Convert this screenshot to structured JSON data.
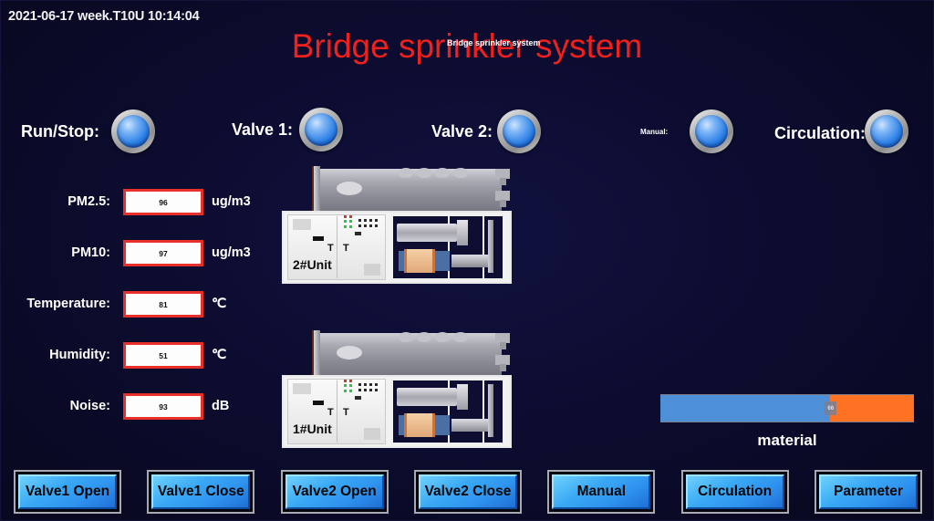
{
  "header": {
    "datetime": "2021-06-17 week.T10U 10:14:04",
    "title": "Bridge sprinkler system",
    "title_overlay": "Bridge sprinkler system"
  },
  "indicators": [
    {
      "label": "Run/Stop:",
      "name": "run-stop",
      "state": "on",
      "color": "#2a7fe8"
    },
    {
      "label": "Valve 1:",
      "name": "valve-1",
      "state": "on",
      "color": "#2a7fe8"
    },
    {
      "label": "Valve 2:",
      "name": "valve-2",
      "state": "on",
      "color": "#2a7fe8"
    },
    {
      "label": "Manual:",
      "name": "manual",
      "state": "on",
      "color": "#2a7fe8"
    },
    {
      "label": "Circulation:",
      "name": "circulation",
      "state": "on",
      "color": "#2a7fe8"
    }
  ],
  "readouts": [
    {
      "label": "PM2.5:",
      "value": "96",
      "unit": "ug/m3"
    },
    {
      "label": "PM10:",
      "value": "97",
      "unit": "ug/m3"
    },
    {
      "label": "Temperature:",
      "value": "81",
      "unit": "℃"
    },
    {
      "label": "Humidity:",
      "value": "51",
      "unit": "℃"
    },
    {
      "label": "Noise:",
      "value": "93",
      "unit": "dB"
    }
  ],
  "units": [
    {
      "name": "2#Unit"
    },
    {
      "name": "1#Unit"
    }
  ],
  "equipment": {
    "fan_icon": "fan-icon",
    "fan_count": 2,
    "nozzle_count": 16
  },
  "material": {
    "label": "material",
    "fill_percent": 67,
    "thumb_value": "66",
    "fill_color": "#4e90d8",
    "remainder_color": "#ff7223"
  },
  "buttons": [
    {
      "label": "Valve1 Open",
      "name": "valve1-open-button"
    },
    {
      "label": "Valve1 Close",
      "name": "valve1-close-button"
    },
    {
      "label": "Valve2 Open",
      "name": "valve2-open-button"
    },
    {
      "label": "Valve2 Close",
      "name": "valve2-close-button"
    },
    {
      "label": "Manual",
      "name": "manual-button"
    },
    {
      "label": "Circulation",
      "name": "circulation-button"
    },
    {
      "label": "Parameter",
      "name": "parameter-button"
    }
  ],
  "theme": {
    "background": "#0c0c30",
    "title_color": "#f0201d",
    "text_color": "#ffffff",
    "flow_color": "#fbe807",
    "button_face": "#3aa9f5"
  }
}
